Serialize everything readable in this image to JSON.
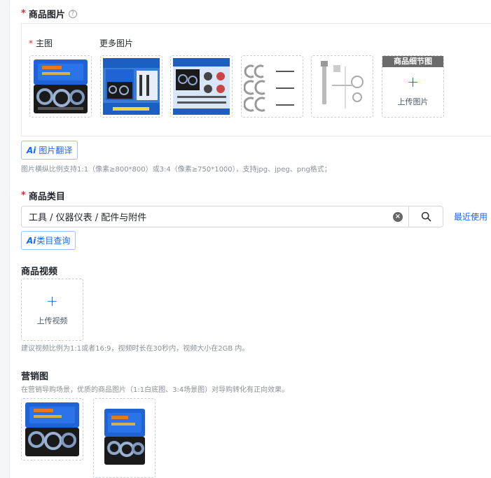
{
  "product_images": {
    "label": "商品图片",
    "help": "?",
    "main_label": "主图",
    "more_label": "更多图片",
    "detail_tile_title": "商品细节图",
    "upload_label": "上传图片",
    "image_translate_ai": "Ai",
    "image_translate_label": "图片翻译",
    "hint": "图片横纵比例支持1:1（像素≥800*800）或3:4（像素≥750*1000），支持jpg、jpeg、png格式；"
  },
  "category": {
    "label": "商品类目",
    "value": "工具 / 仪器仪表 / 配件与附件",
    "clear": "×",
    "recent_label": "最近使用",
    "ai_query_ai": "Ai",
    "ai_query_label": "类目查询"
  },
  "video": {
    "label": "商品视频",
    "upload_label": "上传视频",
    "hint": "建议视频比例为1:1或者16:9，视频时长在30秒内，视频大小在2GB 内。"
  },
  "marketing": {
    "label": "营销图",
    "hint": "在营销导购场景，优质的商品图片（1:1白底图、3:4场景图）对导购转化有正向效果。"
  },
  "colors": {
    "accent": "#1966ff",
    "required": "#f5222d",
    "case_blue": "#1f63d6"
  },
  "icons": {
    "plus": "+",
    "search": "search-icon"
  }
}
